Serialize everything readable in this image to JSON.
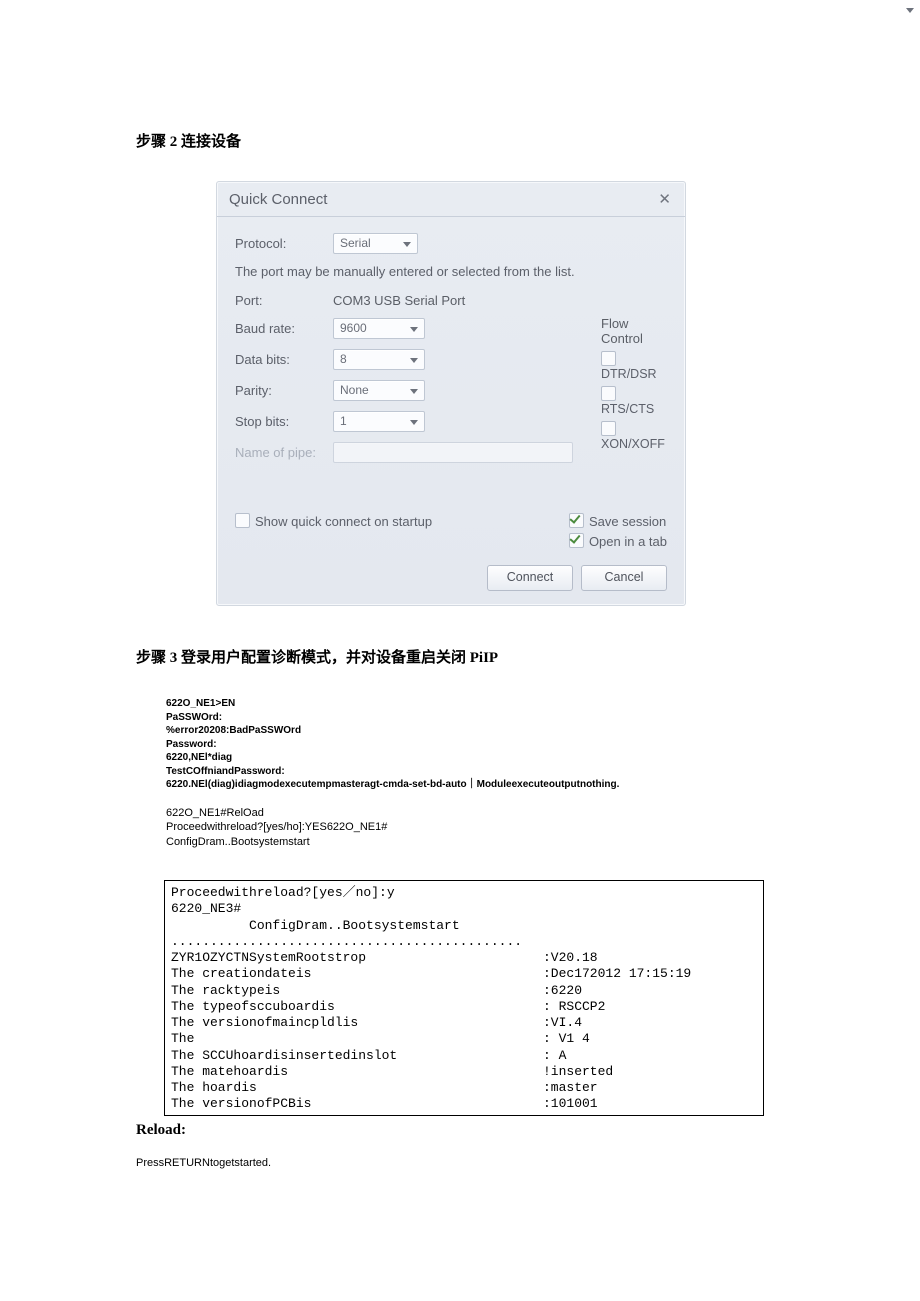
{
  "headings": {
    "h1": "步骤 2 连接设备",
    "h2": "步骤 3 登录用户配置诊断模式，并对设备重启关闭 PiIP"
  },
  "dialog": {
    "title": "Quick Connect",
    "labels": {
      "protocol": "Protocol:",
      "port": "Port:",
      "baud": "Baud rate:",
      "dbits": "Data bits:",
      "parity": "Parity:",
      "stop": "Stop bits:",
      "pipe": "Name of pipe:"
    },
    "values": {
      "protocol": "Serial",
      "port": "COM3 USB Serial Port",
      "baud": "9600",
      "dbits": "8",
      "parity": "None",
      "stop": "1",
      "pipe": ""
    },
    "hint": "The port may be manually entered or selected from the list.",
    "flow": {
      "title": "Flow Control",
      "dtr": "DTR/DSR",
      "rts": "RTS/CTS",
      "xon": "XON/XOFF"
    },
    "footer": {
      "show_on_startup": "Show quick connect on startup",
      "save_session": "Save session",
      "open_tab": "Open in a tab",
      "connect": "Connect",
      "cancel": "Cancel"
    }
  },
  "terminal1": [
    "622O_NE1>EN",
    "PaSSWOrd:",
    "%error20208:BadPaSSWOrd",
    "Password:",
    "6220,NEl*diag",
    "TestCOffniandPassword:",
    " 6220.NEl(diag)idiagmodexecutempmasteragt-cmda-set-bd-auto｜Moduleexecuteoutputnothing."
  ],
  "terminal2": [
    "622O_NE1#RelOad",
    " Proceedwithreload?[yes/ho]:YES622O_NE1#",
    "               ConfigDram..Bootsystemstart"
  ],
  "box": {
    "lines_left": [
      "Proceedwithreload?[yes／no]:y",
      "6220_NE3#",
      "          ConfigDram..Bootsystemstart",
      ".............................................",
      "ZYR1OZYCTNSystemRootstrop",
      "The creationdateis",
      "The racktypeis",
      "The typeofsccuboardis",
      "The versionofmaincpldlis",
      "The",
      "The SCCUhoardisinsertedinslot",
      "The matehoardis",
      "The hoardis",
      "The versionofPCBis"
    ],
    "lines_right": [
      "",
      "",
      "",
      "",
      ":V20.18",
      ":Dec172012 17:15:19",
      ":6220",
      ": RSCCP2",
      ":VI.4",
      ": V1 4",
      ": A",
      "!inserted",
      ":master",
      ":101001"
    ]
  },
  "reload_label": "Reload:",
  "press": "PressRETURNtogetstarted."
}
